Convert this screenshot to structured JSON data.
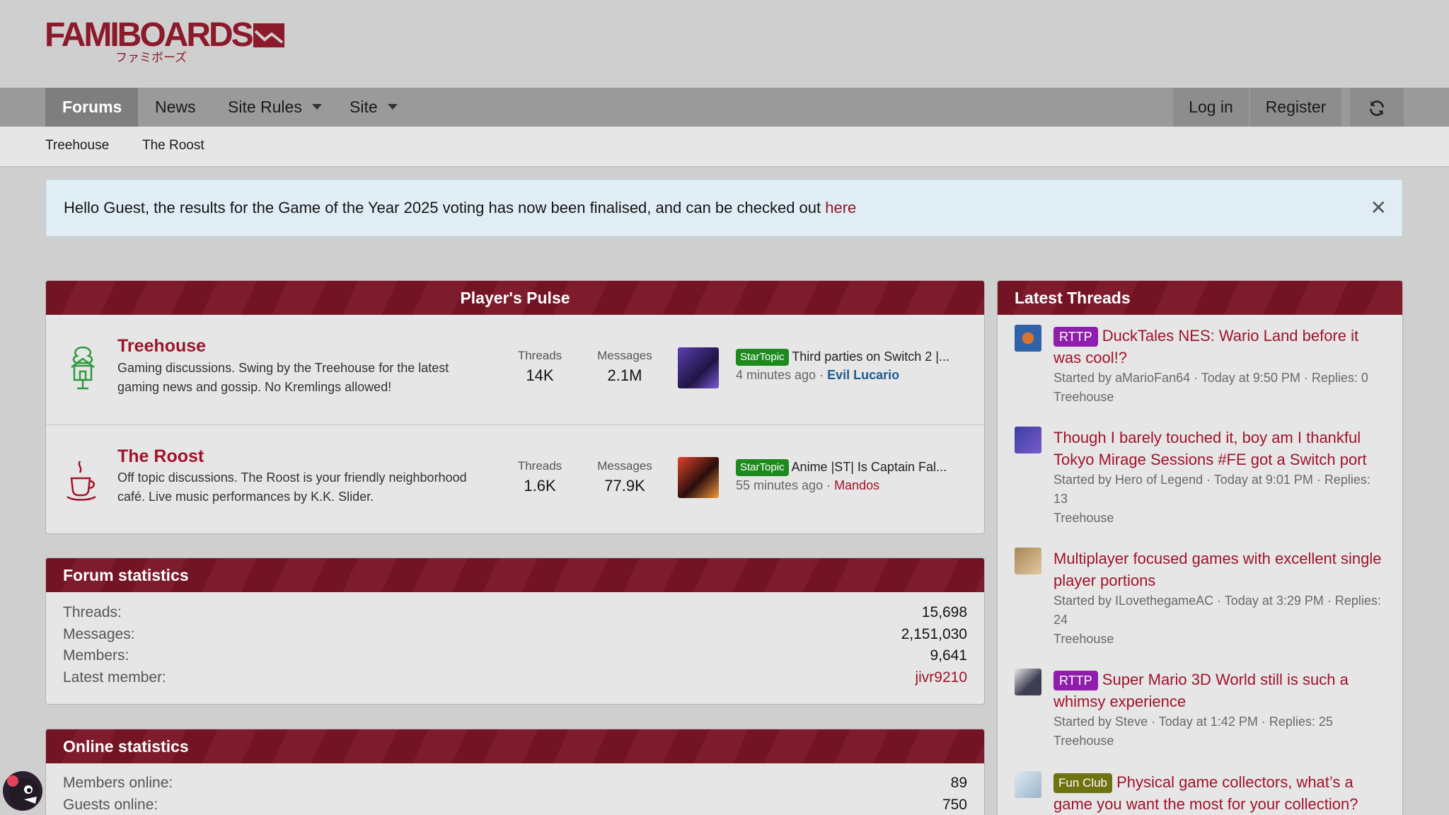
{
  "brand": {
    "name": "FAMIBOARDS",
    "subtitle": "ファミボーズ"
  },
  "nav": {
    "tabs": [
      {
        "label": "Forums",
        "active": true
      },
      {
        "label": "News"
      },
      {
        "label": "Site Rules",
        "has_menu": true
      },
      {
        "label": "Site",
        "has_menu": true
      }
    ],
    "login": "Log in",
    "register": "Register",
    "refresh_icon": "refresh-icon"
  },
  "subnav": {
    "items": [
      "Treehouse",
      "The Roost"
    ]
  },
  "notice": {
    "text": "Hello Guest, the results for the Game of the Year 2025 voting has now been finalised, and can be checked out ",
    "link": "here",
    "close": "✕"
  },
  "pulse": {
    "title": "Player's Pulse",
    "nodes": [
      {
        "title": "Treehouse",
        "description": "Gaming discussions. Swing by the Treehouse for the latest gaming news and gossip. No Kremlings allowed!",
        "threads_label": "Threads",
        "threads": "14K",
        "messages_label": "Messages",
        "messages": "2.1M",
        "last_badge": "StarTopic",
        "last_title": "Third parties on Switch 2 |...",
        "last_time": "4 minutes ago",
        "last_sep": "·",
        "last_user": "Evil Lucario"
      },
      {
        "title": "The Roost",
        "description": "Off topic discussions. The Roost is your friendly neighborhood café. Live music performances by K.K. Slider.",
        "threads_label": "Threads",
        "threads": "1.6K",
        "messages_label": "Messages",
        "messages": "77.9K",
        "last_badge": "StarTopic",
        "last_title": "Anime |ST| Is Captain Fal...",
        "last_time": "55 minutes ago",
        "last_sep": "·",
        "last_user": "Mandos"
      }
    ]
  },
  "forum_stats": {
    "title": "Forum statistics",
    "rows": [
      {
        "label": "Threads:",
        "value": "15,698"
      },
      {
        "label": "Messages:",
        "value": "2,151,030"
      },
      {
        "label": "Members:",
        "value": "9,641"
      },
      {
        "label": "Latest member:",
        "value": "jivr9210"
      }
    ]
  },
  "online_stats": {
    "title": "Online statistics",
    "rows": [
      {
        "label": "Members online:",
        "value": "89"
      },
      {
        "label": "Guests online:",
        "value": "750"
      }
    ]
  },
  "latest": {
    "title": "Latest Threads",
    "items": [
      {
        "prefix": "RTTP",
        "title": "DuckTales NES: Wario Land before it was cool!?",
        "meta": "Started by aMarioFan64 · Today at 9:50 PM · Replies: 0",
        "forum": "Treehouse"
      },
      {
        "prefix": "",
        "title": "Though I barely touched it, boy am I thankful Tokyo Mirage Sessions #FE got a Switch port",
        "meta": "Started by Hero of Legend · Today at 9:01 PM · Replies: 13",
        "forum": "Treehouse"
      },
      {
        "prefix": "",
        "title": "Multiplayer focused games with excellent single player portions",
        "meta": "Started by ILovethegameAC · Today at 3:29 PM · Replies: 24",
        "forum": "Treehouse"
      },
      {
        "prefix": "RTTP",
        "title": "Super Mario 3D World still is such a whimsy experience",
        "meta": "Started by Steve · Today at 1:42 PM · Replies: 25",
        "forum": "Treehouse"
      },
      {
        "prefix": "Fun Club",
        "title": "Physical game collectors, what’s a game you want the most for your collection?",
        "meta": "",
        "forum": ""
      }
    ]
  },
  "colors": {
    "accent": "#8b1a2b",
    "header_bar": "#7a1526",
    "badge_star": "#1c8a1c",
    "badge_rttp": "#8e1eab",
    "badge_fun": "#6e7211"
  }
}
